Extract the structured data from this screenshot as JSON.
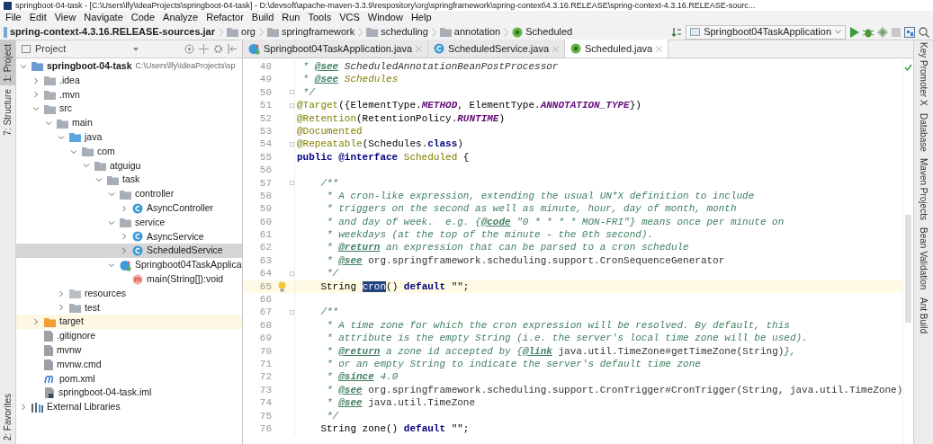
{
  "window": {
    "title": "springboot-04-task - [C:\\Users\\lfy\\IdeaProjects\\springboot-04-task] - D:\\devsoft\\apache-maven-3.3.9\\respository\\org\\springframework\\spring-context\\4.3.16.RELEASE\\spring-context-4.3.16.RELEASE-sourc..."
  },
  "menu": [
    "File",
    "Edit",
    "View",
    "Navigate",
    "Code",
    "Analyze",
    "Refactor",
    "Build",
    "Run",
    "Tools",
    "VCS",
    "Window",
    "Help"
  ],
  "breadcrumbs": [
    {
      "label": "spring-context-4.3.16.RELEASE-sources.jar",
      "kind": "jar"
    },
    {
      "label": "org",
      "kind": "folder"
    },
    {
      "label": "springframework",
      "kind": "folder"
    },
    {
      "label": "scheduling",
      "kind": "folder"
    },
    {
      "label": "annotation",
      "kind": "folder"
    },
    {
      "label": "Scheduled",
      "kind": "annotation"
    }
  ],
  "run_config": "Springboot04TaskApplication",
  "left_stripe": [
    {
      "label": "1: Project",
      "selected": true
    },
    {
      "label": "7: Structure",
      "selected": false
    },
    {
      "label": "2: Favorites",
      "selected": false
    }
  ],
  "right_stripe": [
    "Key Promoter X",
    "Database",
    "Maven Projects",
    "Bean Validation",
    "Ant Build"
  ],
  "project": {
    "title": "Project",
    "tree": [
      {
        "label": "springboot-04-task",
        "hint": "C:\\Users\\lfy\\IdeaProjects\\sp",
        "kind": "module",
        "expanded": true,
        "selected": false,
        "children": [
          {
            "label": ".idea",
            "kind": "folder",
            "expanded": false,
            "selected": false
          },
          {
            "label": ".mvn",
            "kind": "folder",
            "expanded": false,
            "selected": false
          },
          {
            "label": "src",
            "kind": "folder",
            "expanded": true,
            "selected": false,
            "children": [
              {
                "label": "main",
                "kind": "folder",
                "expanded": true,
                "selected": false,
                "children": [
                  {
                    "label": "java",
                    "kind": "source-folder",
                    "expanded": true,
                    "selected": false,
                    "children": [
                      {
                        "label": "com",
                        "kind": "package",
                        "expanded": true,
                        "selected": false,
                        "children": [
                          {
                            "label": "atguigu",
                            "kind": "package",
                            "expanded": true,
                            "selected": false,
                            "children": [
                              {
                                "label": "task",
                                "kind": "package",
                                "expanded": true,
                                "selected": false,
                                "children": [
                                  {
                                    "label": "controller",
                                    "kind": "package",
                                    "expanded": true,
                                    "selected": false,
                                    "children": [
                                      {
                                        "label": "AsyncController",
                                        "kind": "class",
                                        "expanded": false,
                                        "selected": false
                                      }
                                    ]
                                  },
                                  {
                                    "label": "service",
                                    "kind": "package",
                                    "expanded": true,
                                    "selected": false,
                                    "children": [
                                      {
                                        "label": "AsyncService",
                                        "kind": "class",
                                        "expanded": false,
                                        "selected": false
                                      },
                                      {
                                        "label": "ScheduledService",
                                        "kind": "class",
                                        "expanded": false,
                                        "selected": true
                                      }
                                    ]
                                  },
                                  {
                                    "label": "Springboot04TaskApplica",
                                    "kind": "app-class",
                                    "expanded": true,
                                    "selected": false,
                                    "children": [
                                      {
                                        "label": "main(String[]):void",
                                        "kind": "method",
                                        "selected": false
                                      }
                                    ]
                                  }
                                ]
                              }
                            ]
                          }
                        ]
                      }
                    ]
                  },
                  {
                    "label": "resources",
                    "kind": "resources-folder",
                    "expanded": false,
                    "selected": false
                  },
                  {
                    "label": "test",
                    "kind": "folder",
                    "expanded": false,
                    "selected": false
                  }
                ]
              }
            ]
          },
          {
            "label": "target",
            "kind": "excluded-folder",
            "expanded": false,
            "selected": false
          },
          {
            "label": ".gitignore",
            "kind": "file",
            "selected": false
          },
          {
            "label": "mvnw",
            "kind": "file",
            "selected": false
          },
          {
            "label": "mvnw.cmd",
            "kind": "file",
            "selected": false
          },
          {
            "label": "pom.xml",
            "kind": "maven",
            "selected": false
          },
          {
            "label": "springboot-04-task.iml",
            "kind": "iml",
            "selected": false
          }
        ]
      },
      {
        "label": "External Libraries",
        "kind": "libraries",
        "expanded": false,
        "selected": false
      }
    ]
  },
  "tabs": [
    {
      "label": "Springboot04TaskApplication.java",
      "kind": "app-class",
      "selected": false
    },
    {
      "label": "ScheduledService.java",
      "kind": "class",
      "selected": false
    },
    {
      "label": "Scheduled.java",
      "kind": "annotation",
      "selected": true
    }
  ],
  "code": [
    {
      "number": "48",
      "fold": false,
      "current": false,
      "segments": [
        {
          "text": " * ",
          "kind": "comment"
        },
        {
          "text": "@see",
          "kind": "doc-tag"
        },
        {
          "text": " ScheduledAnnotationBeanPostProcessor",
          "kind": "doc-text"
        }
      ]
    },
    {
      "number": "49",
      "fold": false,
      "current": false,
      "segments": [
        {
          "text": " * ",
          "kind": "comment"
        },
        {
          "text": "@see",
          "kind": "doc-tag"
        },
        {
          "text": " Schedules",
          "kind": "doc-class"
        }
      ]
    },
    {
      "number": "50",
      "fold": true,
      "current": false,
      "segments": [
        {
          "text": " */",
          "kind": "comment"
        }
      ]
    },
    {
      "number": "51",
      "fold": true,
      "current": false,
      "segments": [
        {
          "text": "@Target",
          "kind": "annotation"
        },
        {
          "text": "({ElementType.",
          "kind": "plain"
        },
        {
          "text": "METHOD",
          "kind": "constant"
        },
        {
          "text": ", ElementType.",
          "kind": "plain"
        },
        {
          "text": "ANNOTATION_TYPE",
          "kind": "constant"
        },
        {
          "text": "})",
          "kind": "plain"
        }
      ]
    },
    {
      "number": "52",
      "fold": false,
      "current": false,
      "segments": [
        {
          "text": "@Retention",
          "kind": "annotation"
        },
        {
          "text": "(RetentionPolicy.",
          "kind": "plain"
        },
        {
          "text": "RUNTIME",
          "kind": "constant"
        },
        {
          "text": ")",
          "kind": "plain"
        }
      ]
    },
    {
      "number": "53",
      "fold": false,
      "current": false,
      "segments": [
        {
          "text": "@Documented",
          "kind": "annotation"
        }
      ]
    },
    {
      "number": "54",
      "fold": true,
      "current": false,
      "segments": [
        {
          "text": "@Repeatable",
          "kind": "annotation"
        },
        {
          "text": "(Schedules.",
          "kind": "plain"
        },
        {
          "text": "class",
          "kind": "keyword"
        },
        {
          "text": ")",
          "kind": "plain"
        }
      ]
    },
    {
      "number": "55",
      "fold": false,
      "current": false,
      "segments": [
        {
          "text": "public @interface",
          "kind": "keyword"
        },
        {
          "text": " Scheduled",
          "kind": "annotation"
        },
        {
          "text": " {",
          "kind": "plain"
        }
      ]
    },
    {
      "number": "56",
      "fold": false,
      "current": false
    },
    {
      "number": "57",
      "fold": true,
      "current": false,
      "segments": [
        {
          "text": "    /**",
          "kind": "comment"
        }
      ]
    },
    {
      "number": "58",
      "fold": false,
      "current": false,
      "segments": [
        {
          "text": "     * A cron-like expression, extending the usual UN*X definition to include",
          "kind": "comment"
        }
      ]
    },
    {
      "number": "59",
      "fold": false,
      "current": false,
      "segments": [
        {
          "text": "     * triggers on the second as well as minute, hour, day of month, month",
          "kind": "comment"
        }
      ]
    },
    {
      "number": "60",
      "fold": false,
      "current": false,
      "segments": [
        {
          "text": "     * and day of week.  e.g. {",
          "kind": "comment"
        },
        {
          "text": "@code",
          "kind": "doc-tag"
        },
        {
          "text": " \"0 * * * * MON-FRI\"} means once per minute on",
          "kind": "comment"
        }
      ]
    },
    {
      "number": "61",
      "fold": false,
      "current": false,
      "segments": [
        {
          "text": "     * weekdays (at the top of the minute - the 0th second).",
          "kind": "comment"
        }
      ]
    },
    {
      "number": "62",
      "fold": false,
      "current": false,
      "segments": [
        {
          "text": "     * ",
          "kind": "comment"
        },
        {
          "text": "@return",
          "kind": "doc-tag"
        },
        {
          "text": " an expression that can be parsed to a cron schedule",
          "kind": "comment"
        }
      ]
    },
    {
      "number": "63",
      "fold": false,
      "current": false,
      "segments": [
        {
          "text": "     * ",
          "kind": "comment"
        },
        {
          "text": "@see",
          "kind": "doc-tag"
        },
        {
          "text": " org.springframework.scheduling.support.CronSequenceGenerator",
          "kind": "doc-ref"
        }
      ]
    },
    {
      "number": "64",
      "fold": true,
      "current": false,
      "segments": [
        {
          "text": "     */",
          "kind": "comment"
        }
      ]
    },
    {
      "number": "65",
      "fold": false,
      "current": true,
      "segments": [
        {
          "text": "    String ",
          "kind": "plain"
        },
        {
          "text": "cron",
          "kind": "selection"
        },
        {
          "text": "() ",
          "kind": "plain"
        },
        {
          "text": "default",
          "kind": "keyword"
        },
        {
          "text": " \"\";",
          "kind": "plain"
        }
      ]
    },
    {
      "number": "66",
      "fold": false,
      "current": false
    },
    {
      "number": "67",
      "fold": true,
      "current": false,
      "segments": [
        {
          "text": "    /**",
          "kind": "comment"
        }
      ]
    },
    {
      "number": "68",
      "fold": false,
      "current": false,
      "segments": [
        {
          "text": "     * A time zone for which the cron expression will be resolved. By default, this",
          "kind": "comment"
        }
      ]
    },
    {
      "number": "69",
      "fold": false,
      "current": false,
      "segments": [
        {
          "text": "     * attribute is the empty String (i.e. the server's local time zone will be used).",
          "kind": "comment"
        }
      ]
    },
    {
      "number": "70",
      "fold": false,
      "current": false,
      "segments": [
        {
          "text": "     * ",
          "kind": "comment"
        },
        {
          "text": "@return",
          "kind": "doc-tag"
        },
        {
          "text": " a zone id accepted by {",
          "kind": "comment"
        },
        {
          "text": "@link",
          "kind": "doc-tag"
        },
        {
          "text": " java.util.TimeZone#getTimeZone(String)",
          "kind": "doc-ref"
        },
        {
          "text": "},",
          "kind": "comment"
        }
      ]
    },
    {
      "number": "71",
      "fold": false,
      "current": false,
      "segments": [
        {
          "text": "     * or an empty String to indicate the server's default time zone",
          "kind": "comment"
        }
      ]
    },
    {
      "number": "72",
      "fold": false,
      "current": false,
      "segments": [
        {
          "text": "     * ",
          "kind": "comment"
        },
        {
          "text": "@since",
          "kind": "doc-tag"
        },
        {
          "text": " 4.0",
          "kind": "comment"
        }
      ]
    },
    {
      "number": "73",
      "fold": false,
      "current": false,
      "segments": [
        {
          "text": "     * ",
          "kind": "comment"
        },
        {
          "text": "@see",
          "kind": "doc-tag"
        },
        {
          "text": " org.springframework.scheduling.support.CronTrigger#CronTrigger(String, java.util.TimeZone)",
          "kind": "doc-ref"
        }
      ]
    },
    {
      "number": "74",
      "fold": false,
      "current": false,
      "segments": [
        {
          "text": "     * ",
          "kind": "comment"
        },
        {
          "text": "@see",
          "kind": "doc-tag"
        },
        {
          "text": " java.util.TimeZone",
          "kind": "doc-ref"
        }
      ]
    },
    {
      "number": "75",
      "fold": false,
      "current": false,
      "segments": [
        {
          "text": "     */",
          "kind": "comment"
        }
      ]
    },
    {
      "number": "76",
      "fold": false,
      "current": false,
      "segments": [
        {
          "text": "    String zone() ",
          "kind": "plain"
        },
        {
          "text": "default",
          "kind": "keyword"
        },
        {
          "text": " \"\";",
          "kind": "plain"
        }
      ]
    }
  ]
}
